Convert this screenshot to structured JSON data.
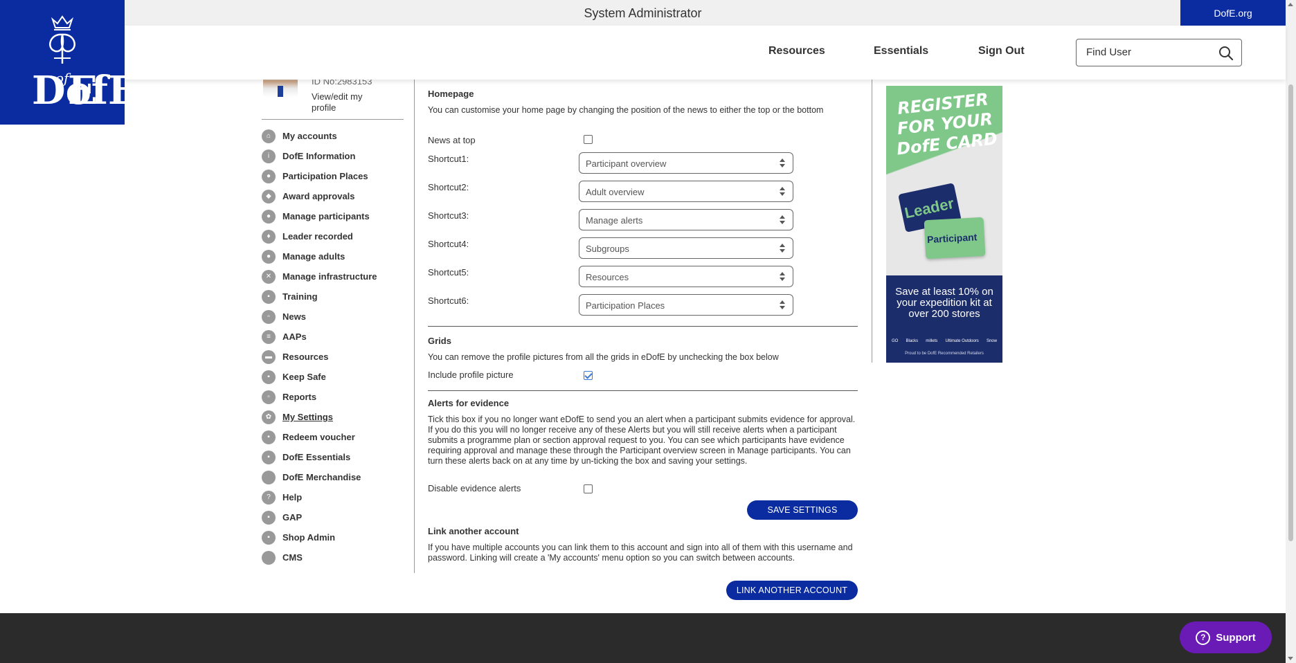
{
  "header": {
    "title": "System Administrator",
    "dofe_link": "DofE.org",
    "nav": [
      "Resources",
      "Essentials",
      "Sign Out"
    ],
    "search_placeholder": "Find User"
  },
  "logo": {
    "text": "DofE",
    "of": "of"
  },
  "profile": {
    "id": "ID No:2983153",
    "edit_link": "View/edit my profile"
  },
  "sidebar": {
    "items": [
      {
        "label": "My accounts",
        "icon": "home-icon"
      },
      {
        "label": "DofE Information",
        "icon": "info-icon"
      },
      {
        "label": "Participation Places",
        "icon": "person-icon"
      },
      {
        "label": "Award approvals",
        "icon": "shield-icon"
      },
      {
        "label": "Manage participants",
        "icon": "people-icon"
      },
      {
        "label": "Leader recorded",
        "icon": "leader-icon"
      },
      {
        "label": "Manage adults",
        "icon": "adults-icon"
      },
      {
        "label": "Manage infrastructure",
        "icon": "infrastructure-icon"
      },
      {
        "label": "Training",
        "icon": "training-icon"
      },
      {
        "label": "News",
        "icon": "news-icon"
      },
      {
        "label": "AAPs",
        "icon": "list-icon"
      },
      {
        "label": "Resources",
        "icon": "folder-icon"
      },
      {
        "label": "Keep Safe",
        "icon": "lock-icon"
      },
      {
        "label": "Reports",
        "icon": "report-icon"
      },
      {
        "label": "My Settings",
        "icon": "gear-icon",
        "active": true
      },
      {
        "label": "Redeem voucher",
        "icon": "voucher-icon"
      },
      {
        "label": "DofE Essentials",
        "icon": "cart-icon"
      },
      {
        "label": "DofE Merchandise",
        "icon": "merch-icon"
      },
      {
        "label": "Help",
        "icon": "help-icon"
      },
      {
        "label": "GAP",
        "icon": "gap-icon"
      },
      {
        "label": "Shop Admin",
        "icon": "shop-icon"
      },
      {
        "label": "CMS",
        "icon": "cms-icon"
      }
    ]
  },
  "homepage": {
    "title": "Homepage",
    "desc": "You can customise your home page by changing the position of the news to either the top or the bottom",
    "news_at_top_label": "News at top",
    "news_at_top": false,
    "shortcuts": [
      {
        "label": "Shortcut1:",
        "value": "Participant overview"
      },
      {
        "label": "Shortcut2:",
        "value": "Adult overview"
      },
      {
        "label": "Shortcut3:",
        "value": "Manage alerts"
      },
      {
        "label": "Shortcut4:",
        "value": "Subgroups"
      },
      {
        "label": "Shortcut5:",
        "value": "Resources"
      },
      {
        "label": "Shortcut6:",
        "value": "Participation Places"
      }
    ]
  },
  "grids": {
    "title": "Grids",
    "desc": "You can remove the profile pictures from all the grids in eDofE by unchecking the box below",
    "include_label": "Include profile picture",
    "include": true
  },
  "alerts": {
    "title": "Alerts for evidence",
    "desc": "Tick this box if you no longer want eDofE to send you an alert when a participant submits evidence for approval. If you do this you will no longer receive any of these Alerts but you will still receive alerts when a participant submits a programme plan or section approval request to you. You can see which participants have evidence requiring approval and manage these through the Participant overview screen in Manage participants. You can turn these alerts back on at any time by un-ticking the box and saving your settings.",
    "disable_label": "Disable evidence alerts",
    "disable": false,
    "save_button": "SAVE SETTINGS"
  },
  "link_account": {
    "title": "Link another account",
    "desc": "If you have multiple accounts you can link them to this account and sign into all of them with this username and password. Linking will create a 'My accounts' menu option so you can switch between accounts.",
    "button": "LINK ANOTHER ACCOUNT"
  },
  "ad": {
    "headline": "REGISTER FOR YOUR DofE CARD",
    "card1": "Leader",
    "card2": "Participant",
    "offer": "Save at least 10% on your expedition kit at over 200 stores",
    "retailers": [
      "GO",
      "Blacks",
      "millets",
      "Ultimate Outdoors",
      "Snow"
    ],
    "proud": "Proud to be DofE Recommended Retailers"
  },
  "support": {
    "label": "Support"
  },
  "colors": {
    "brand": "#0a2ca0",
    "support": "#6a1bb5",
    "footer": "#2b2b2b"
  }
}
